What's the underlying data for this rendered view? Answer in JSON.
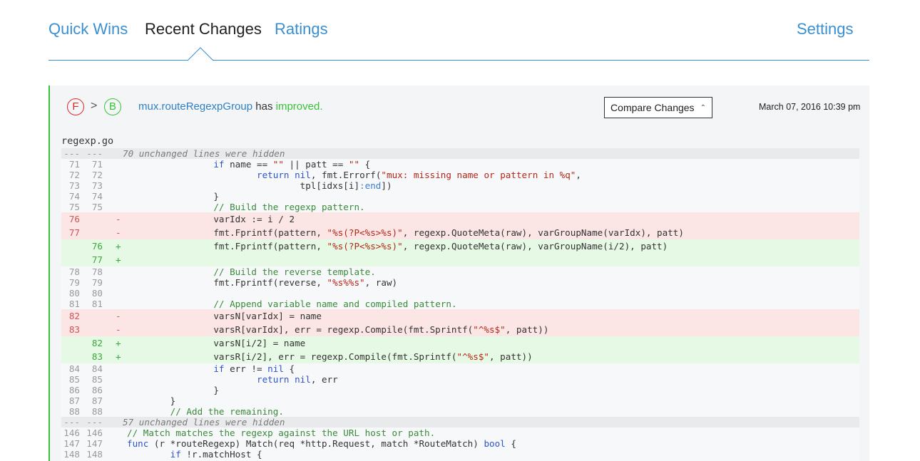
{
  "nav": {
    "tabs": [
      {
        "label": "Quick Wins",
        "active": false
      },
      {
        "label": "Recent Changes",
        "active": true
      },
      {
        "label": "Ratings",
        "active": false
      }
    ],
    "settings_label": "Settings",
    "accent_color": "#3a8fd0"
  },
  "change": {
    "grade_before": "F",
    "grade_after": "B",
    "arrow": ">",
    "function_name": "mux.routeRegexpGroup",
    "verb": "has",
    "status": "improved.",
    "compare_button": "Compare Changes",
    "timestamp": "March 07, 2016 10:39 pm",
    "filename": "regexp.go",
    "colors": {
      "bad": "#d62b2b",
      "good": "#39c239",
      "deleted_bg": "#fbe5e5",
      "added_bg": "#e6f9e4"
    }
  },
  "diff": [
    {
      "type": "hunk",
      "old": "---",
      "new": "---",
      "text": "70 unchanged lines were hidden"
    },
    {
      "type": "ctx",
      "old": "71",
      "new": "71",
      "tokens": [
        [
          "",
          "\t\t"
        ],
        [
          "kw",
          "if"
        ],
        [
          "",
          " name == "
        ],
        [
          "str",
          "\"\""
        ],
        [
          "",
          " || patt == "
        ],
        [
          "str",
          "\"\""
        ],
        [
          "",
          " {"
        ]
      ]
    },
    {
      "type": "ctx",
      "old": "72",
      "new": "72",
      "tokens": [
        [
          "",
          "\t\t\t"
        ],
        [
          "kw",
          "return"
        ],
        [
          "",
          " "
        ],
        [
          "kw",
          "nil"
        ],
        [
          "",
          ", fmt.Errorf("
        ],
        [
          "str",
          "\"mux: missing name or pattern in %q\""
        ],
        [
          "",
          ","
        ]
      ]
    },
    {
      "type": "ctx",
      "old": "73",
      "new": "73",
      "tokens": [
        [
          "",
          "\t\t\t\ttpl[idxs[i]"
        ],
        [
          "fd",
          ":end"
        ],
        [
          "",
          "])"
        ]
      ]
    },
    {
      "type": "ctx",
      "old": "74",
      "new": "74",
      "tokens": [
        [
          "",
          "\t\t}"
        ]
      ]
    },
    {
      "type": "ctx",
      "old": "75",
      "new": "75",
      "tokens": [
        [
          "",
          "\t\t"
        ],
        [
          "cm",
          "// Build the regexp pattern."
        ]
      ]
    },
    {
      "type": "del",
      "old": "76",
      "new": "",
      "sign": "-",
      "tokens": [
        [
          "",
          "\t\tvarIdx := i / 2"
        ]
      ]
    },
    {
      "type": "del",
      "old": "77",
      "new": "",
      "sign": "-",
      "tokens": [
        [
          "",
          "\t\tfmt.Fprintf(pattern, "
        ],
        [
          "str",
          "\"%s(?P<%s>%s)\""
        ],
        [
          "",
          ", regexp.QuoteMeta(raw), varGroupName(varIdx), patt)"
        ]
      ]
    },
    {
      "type": "add",
      "old": "",
      "new": "76",
      "sign": "+",
      "tokens": [
        [
          "",
          "\t\tfmt.Fprintf(pattern, "
        ],
        [
          "str",
          "\"%s(?P<%s>%s)\""
        ],
        [
          "",
          ", regexp.QuoteMeta(raw), varGroupName(i/2), patt)"
        ]
      ]
    },
    {
      "type": "add",
      "old": "",
      "new": "77",
      "sign": "+",
      "tokens": [
        [
          "",
          ""
        ]
      ]
    },
    {
      "type": "ctx",
      "old": "78",
      "new": "78",
      "tokens": [
        [
          "",
          "\t\t"
        ],
        [
          "cm",
          "// Build the reverse template."
        ]
      ]
    },
    {
      "type": "ctx",
      "old": "79",
      "new": "79",
      "tokens": [
        [
          "",
          "\t\tfmt.Fprintf(reverse, "
        ],
        [
          "str",
          "\"%s%%s\""
        ],
        [
          "",
          ", raw)"
        ]
      ]
    },
    {
      "type": "ctx",
      "old": "80",
      "new": "80",
      "tokens": [
        [
          "",
          ""
        ]
      ]
    },
    {
      "type": "ctx",
      "old": "81",
      "new": "81",
      "tokens": [
        [
          "",
          "\t\t"
        ],
        [
          "cm",
          "// Append variable name and compiled pattern."
        ]
      ]
    },
    {
      "type": "del",
      "old": "82",
      "new": "",
      "sign": "-",
      "tokens": [
        [
          "",
          "\t\tvarsN[varIdx] = name"
        ]
      ]
    },
    {
      "type": "del",
      "old": "83",
      "new": "",
      "sign": "-",
      "tokens": [
        [
          "",
          "\t\tvarsR[varIdx], err = regexp.Compile(fmt.Sprintf("
        ],
        [
          "str",
          "\"^%s$\""
        ],
        [
          "",
          ", patt))"
        ]
      ]
    },
    {
      "type": "add",
      "old": "",
      "new": "82",
      "sign": "+",
      "tokens": [
        [
          "",
          "\t\tvarsN[i/2] = name"
        ]
      ]
    },
    {
      "type": "add",
      "old": "",
      "new": "83",
      "sign": "+",
      "tokens": [
        [
          "",
          "\t\tvarsR[i/2], err = regexp.Compile(fmt.Sprintf("
        ],
        [
          "str",
          "\"^%s$\""
        ],
        [
          "",
          ", patt))"
        ]
      ]
    },
    {
      "type": "ctx",
      "old": "84",
      "new": "84",
      "tokens": [
        [
          "",
          "\t\t"
        ],
        [
          "kw",
          "if"
        ],
        [
          "",
          " err != "
        ],
        [
          "kw",
          "nil"
        ],
        [
          "",
          " {"
        ]
      ]
    },
    {
      "type": "ctx",
      "old": "85",
      "new": "85",
      "tokens": [
        [
          "",
          "\t\t\t"
        ],
        [
          "kw",
          "return"
        ],
        [
          "",
          " "
        ],
        [
          "kw",
          "nil"
        ],
        [
          "",
          ", err"
        ]
      ]
    },
    {
      "type": "ctx",
      "old": "86",
      "new": "86",
      "tokens": [
        [
          "",
          "\t\t}"
        ]
      ]
    },
    {
      "type": "ctx",
      "old": "87",
      "new": "87",
      "tokens": [
        [
          "",
          "\t}"
        ]
      ]
    },
    {
      "type": "ctx",
      "old": "88",
      "new": "88",
      "tokens": [
        [
          "",
          "\t"
        ],
        [
          "cm",
          "// Add the remaining."
        ]
      ]
    },
    {
      "type": "hunk",
      "old": "---",
      "new": "---",
      "text": "57 unchanged lines were hidden"
    },
    {
      "type": "ctx",
      "old": "146",
      "new": "146",
      "tokens": [
        [
          "cm",
          "// Match matches the regexp against the URL host or path."
        ]
      ]
    },
    {
      "type": "ctx",
      "old": "147",
      "new": "147",
      "tokens": [
        [
          "kw",
          "func"
        ],
        [
          "",
          " (r *routeRegexp) Match(req *http.Request, match *RouteMatch) "
        ],
        [
          "kw",
          "bool"
        ],
        [
          "",
          " {"
        ]
      ]
    },
    {
      "type": "ctx",
      "old": "148",
      "new": "148",
      "tokens": [
        [
          "",
          "\t"
        ],
        [
          "kw",
          "if"
        ],
        [
          "",
          " !r.matchHost {"
        ]
      ]
    }
  ]
}
